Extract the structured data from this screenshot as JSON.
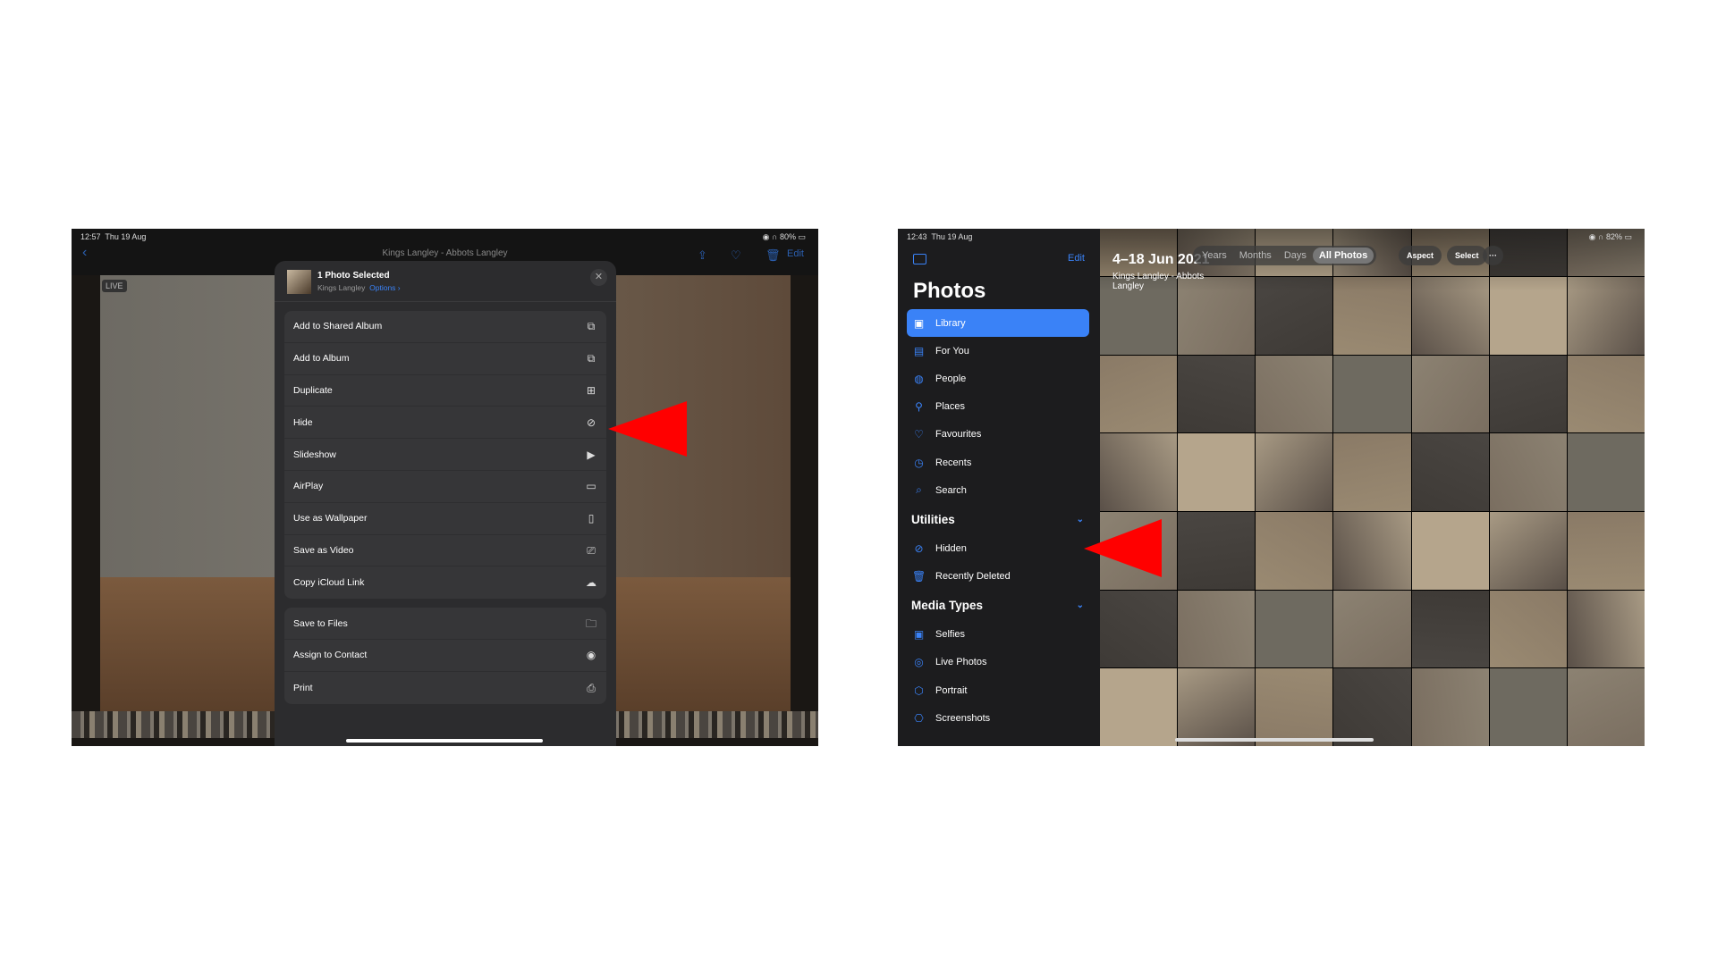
{
  "left": {
    "status": {
      "time": "12:57",
      "date": "Thu 19 Aug",
      "battery": "80%"
    },
    "nav_title": "Kings Langley - Abbots Langley",
    "edit_label": "Edit",
    "live_badge": "LIVE",
    "sheet": {
      "title": "1 Photo Selected",
      "location": "Kings Langley",
      "options": "Options ›",
      "group1": [
        {
          "label": "Add to Shared Album",
          "icon": "shared-album-icon"
        },
        {
          "label": "Add to Album",
          "icon": "album-icon"
        },
        {
          "label": "Duplicate",
          "icon": "duplicate-icon"
        },
        {
          "label": "Hide",
          "icon": "eye-slash-icon"
        },
        {
          "label": "Slideshow",
          "icon": "play-icon"
        },
        {
          "label": "AirPlay",
          "icon": "airplay-icon"
        },
        {
          "label": "Use as Wallpaper",
          "icon": "wallpaper-icon"
        },
        {
          "label": "Save as Video",
          "icon": "video-icon"
        },
        {
          "label": "Copy iCloud Link",
          "icon": "cloud-link-icon"
        }
      ],
      "group2": [
        {
          "label": "Save to Files",
          "icon": "folder-icon"
        },
        {
          "label": "Assign to Contact",
          "icon": "contact-icon"
        },
        {
          "label": "Print",
          "icon": "printer-icon"
        }
      ]
    }
  },
  "right": {
    "status": {
      "time": "12:43",
      "date": "Thu 19 Aug",
      "battery": "82%"
    },
    "sidebar": {
      "edit": "Edit",
      "title": "Photos",
      "items": [
        {
          "label": "Library",
          "icon": "library-icon",
          "active": true
        },
        {
          "label": "For You",
          "icon": "for-you-icon"
        },
        {
          "label": "People",
          "icon": "people-icon"
        },
        {
          "label": "Places",
          "icon": "places-icon"
        },
        {
          "label": "Favourites",
          "icon": "heart-icon"
        },
        {
          "label": "Recents",
          "icon": "clock-icon"
        },
        {
          "label": "Search",
          "icon": "search-icon"
        }
      ],
      "utilities": {
        "title": "Utilities",
        "items": [
          {
            "label": "Hidden",
            "icon": "eye-slash-icon"
          },
          {
            "label": "Recently Deleted",
            "icon": "trash-icon"
          }
        ]
      },
      "media_types": {
        "title": "Media Types",
        "items": [
          {
            "label": "Selfies",
            "icon": "selfie-icon"
          },
          {
            "label": "Live Photos",
            "icon": "live-photo-icon"
          },
          {
            "label": "Portrait",
            "icon": "cube-icon"
          },
          {
            "label": "Screenshots",
            "icon": "screenshot-icon"
          }
        ]
      }
    },
    "header": {
      "date": "4–18 Jun 2021",
      "location": "Kings Langley - Abbots Langley",
      "tabs": [
        "Years",
        "Months",
        "Days",
        "All Photos"
      ],
      "active_tab": "All Photos",
      "aspect": "Aspect",
      "select": "Select",
      "more": "···"
    }
  },
  "colors": {
    "accent": "#3a82f7",
    "annotation_arrow": "#ff0000"
  }
}
